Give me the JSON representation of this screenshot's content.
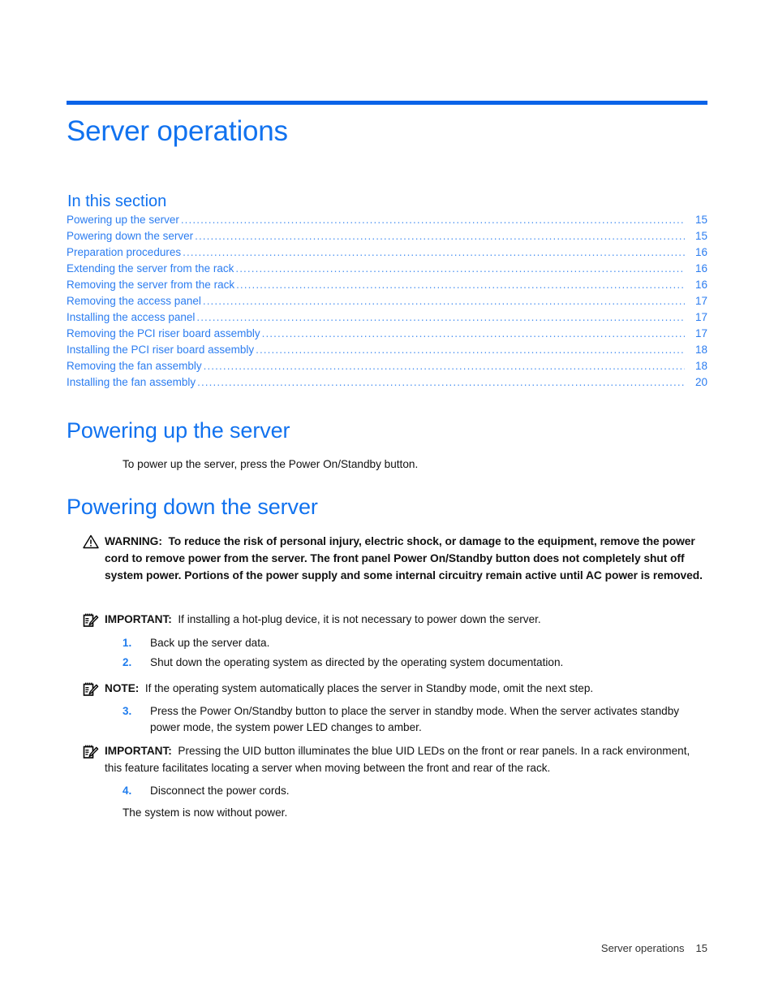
{
  "document": {
    "chapter_title": "Server operations",
    "accent_color": "#0a63e8",
    "heading_color": "#1172ef",
    "link_color": "#2c7df0"
  },
  "toc": {
    "heading": "In this section",
    "dot_leader": "....................................................................................................................................................",
    "entries": [
      {
        "label": "Powering up the server",
        "page": "15"
      },
      {
        "label": "Powering down the server",
        "page": "15"
      },
      {
        "label": "Preparation procedures",
        "page": "16"
      },
      {
        "label": "Extending the server from the rack",
        "page": "16"
      },
      {
        "label": "Removing the server from the rack",
        "page": "16"
      },
      {
        "label": "Removing the access panel",
        "page": "17"
      },
      {
        "label": "Installing the access panel",
        "page": "17"
      },
      {
        "label": "Removing the PCI riser board assembly",
        "page": "17"
      },
      {
        "label": "Installing the PCI riser board assembly",
        "page": "18"
      },
      {
        "label": "Removing the fan assembly",
        "page": "18"
      },
      {
        "label": "Installing the fan assembly",
        "page": "20"
      }
    ]
  },
  "sections": {
    "powering_up": {
      "heading": "Powering up the server",
      "paragraph": "To power up the server, press the Power On/Standby button."
    },
    "powering_down": {
      "heading": "Powering down the server",
      "warning": {
        "lead": "WARNING:",
        "text": "To reduce the risk of personal injury, electric shock, or damage to the equipment, remove the power cord to remove power from the server. The front panel Power On/Standby button does not completely shut off system power. Portions of the power supply and some internal circuitry remain active until AC power is removed."
      },
      "important_1": {
        "lead": "IMPORTANT:",
        "text": "If installing a hot-plug device, it is not necessary to power down the server."
      },
      "step_1": {
        "num": "1.",
        "text": "Back up the server data."
      },
      "step_2": {
        "num": "2.",
        "text": "Shut down the operating system as directed by the operating system documentation."
      },
      "note": {
        "lead": "NOTE:",
        "text": "If the operating system automatically places the server in Standby mode, omit the next step."
      },
      "step_3": {
        "num": "3.",
        "text": "Press the Power On/Standby button to place the server in standby mode. When the server activates standby power mode, the system power LED changes to amber."
      },
      "important_2": {
        "lead": "IMPORTANT:",
        "text": "Pressing the UID button illuminates the blue UID LEDs on the front or rear panels. In a rack environment, this feature facilitates locating a server when moving between the front and rear of the rack."
      },
      "step_4": {
        "num": "4.",
        "text": "Disconnect the power cords."
      },
      "closing_paragraph": "The system is now without power."
    }
  },
  "footer": {
    "title": "Server operations",
    "page": "15"
  }
}
